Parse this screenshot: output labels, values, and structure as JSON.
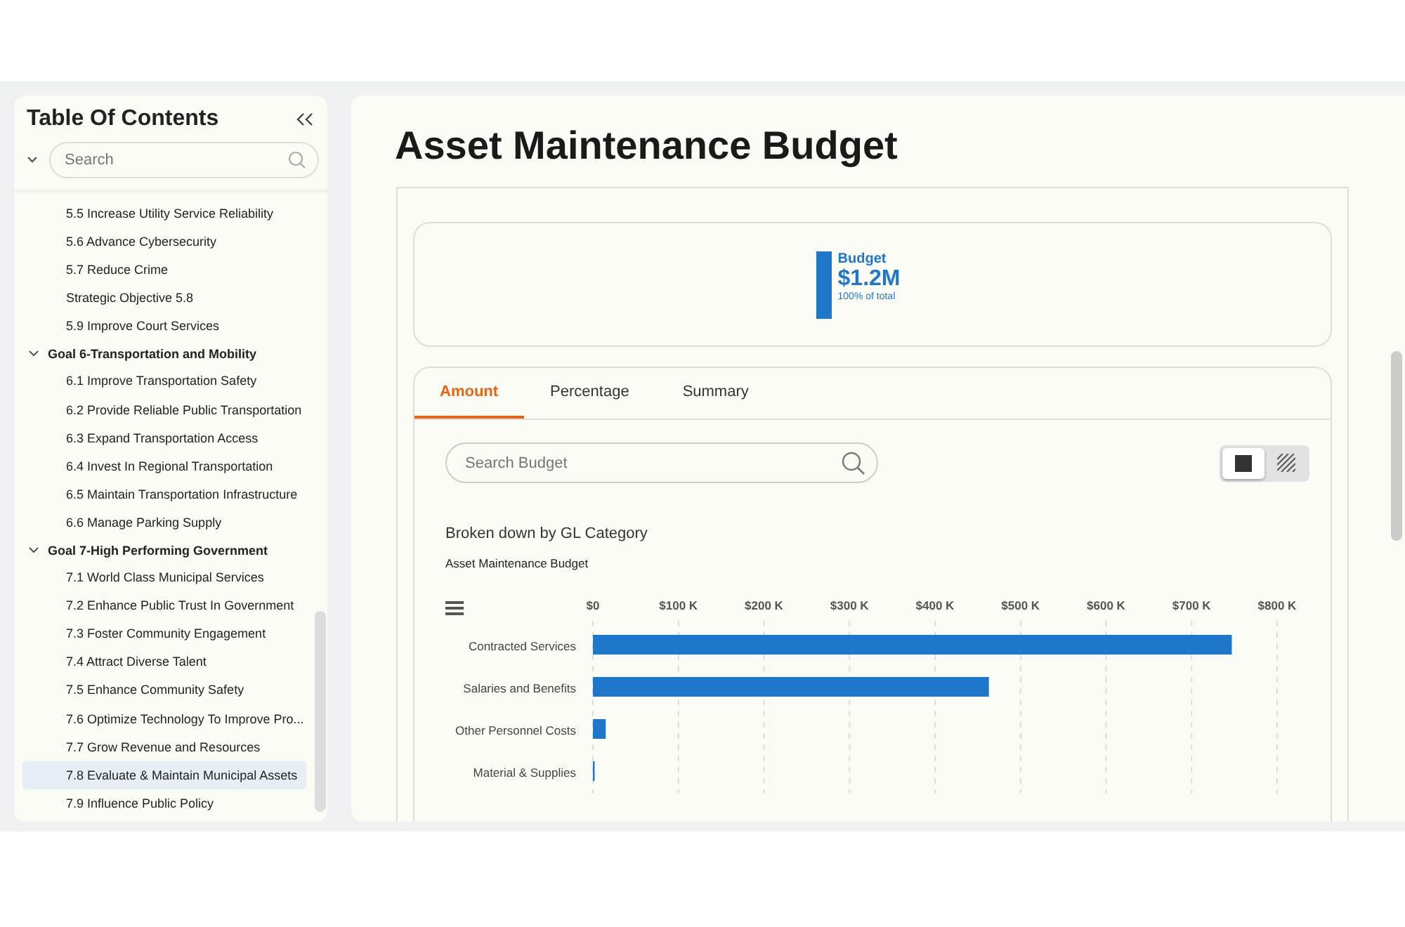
{
  "toc": {
    "title": "Table Of Contents",
    "search": {
      "placeholder": "Search"
    },
    "continued_items": [
      {
        "label": "5.5 Increase Utility Service Reliability",
        "selected": false
      },
      {
        "label": "5.6 Advance Cybersecurity",
        "selected": false
      },
      {
        "label": "5.7 Reduce Crime",
        "selected": false
      },
      {
        "label": "Strategic Objective 5.8",
        "selected": false
      },
      {
        "label": "5.9 Improve Court Services",
        "selected": false
      }
    ],
    "goals": [
      {
        "label": "Goal 6-Transportation and Mobility",
        "expanded": true,
        "children": [
          {
            "label": "6.1 Improve Transportation Safety",
            "selected": false
          },
          {
            "label": "6.2 Provide Reliable Public Transportation",
            "selected": false
          },
          {
            "label": "6.3 Expand Transportation Access",
            "selected": false
          },
          {
            "label": "6.4 Invest In Regional Transportation",
            "selected": false
          },
          {
            "label": "6.5 Maintain Transportation Infrastructure",
            "selected": false
          },
          {
            "label": "6.6 Manage Parking Supply",
            "selected": false
          }
        ]
      },
      {
        "label": "Goal 7-High Performing Government",
        "expanded": true,
        "children": [
          {
            "label": "7.1 World Class Municipal Services",
            "selected": false
          },
          {
            "label": "7.2 Enhance Public Trust In Government",
            "selected": false
          },
          {
            "label": "7.3 Foster Community Engagement",
            "selected": false
          },
          {
            "label": "7.4 Attract Diverse Talent",
            "selected": false
          },
          {
            "label": "7.5 Enhance Community Safety",
            "selected": false
          },
          {
            "label": "7.6 Optimize Technology To Improve Pro...",
            "selected": false
          },
          {
            "label": "7.7 Grow Revenue and Resources",
            "selected": false
          },
          {
            "label": "7.8 Evaluate & Maintain Municipal Assets",
            "selected": true
          },
          {
            "label": "7.9 Influence Public Policy",
            "selected": false
          }
        ]
      }
    ]
  },
  "page": {
    "title": "Asset Maintenance Budget",
    "kpi": {
      "label": "Budget",
      "value": "$1.2M",
      "note": "100% of total"
    },
    "tabs": [
      {
        "label": "Amount",
        "selected": true
      },
      {
        "label": "Percentage",
        "selected": false
      },
      {
        "label": "Summary",
        "selected": false
      }
    ],
    "search": {
      "placeholder": "Search Budget"
    },
    "view_toggle": [
      {
        "kind": "solid",
        "selected": true
      },
      {
        "kind": "hatched",
        "selected": false
      }
    ],
    "breakdown_label": "Broken down by GL Category",
    "chart_data": {
      "type": "bar",
      "orientation": "horizontal",
      "title": "Asset Maintenance Budget",
      "categories": [
        "Contracted Services",
        "Salaries and Benefits",
        "Other Personnel Costs",
        "Material & Supplies"
      ],
      "series": [
        {
          "color": "#1f77cc",
          "values": [
            747000,
            463000,
            15000,
            2000
          ]
        }
      ],
      "grid": true,
      "xlim": [
        0,
        800000
      ],
      "xticks": [
        {
          "value": 0,
          "label": "$0"
        },
        {
          "value": 100000,
          "label": "$100 K"
        },
        {
          "value": 200000,
          "label": "$200 K"
        },
        {
          "value": 300000,
          "label": "$300 K"
        },
        {
          "value": 400000,
          "label": "$400 K"
        },
        {
          "value": 500000,
          "label": "$500 K"
        },
        {
          "value": 600000,
          "label": "$600 K"
        },
        {
          "value": 700000,
          "label": "$700 K"
        },
        {
          "value": 800000,
          "label": "$800 K"
        }
      ]
    }
  }
}
